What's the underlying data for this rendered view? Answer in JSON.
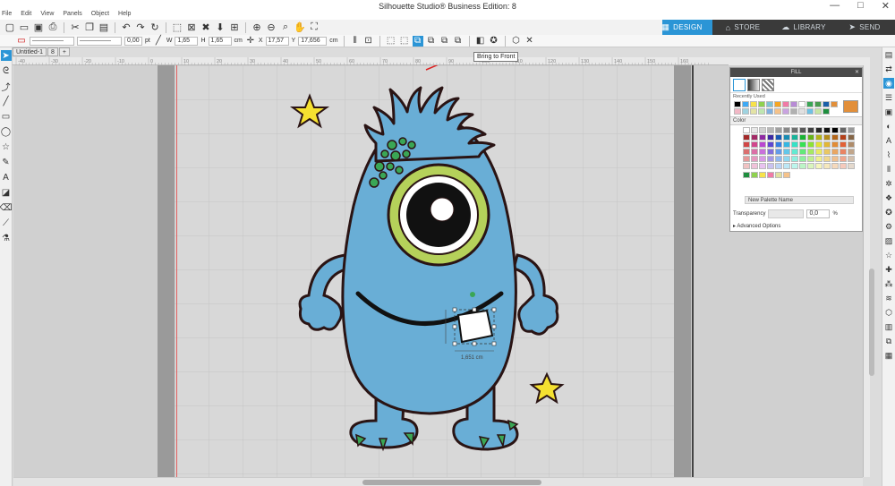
{
  "window": {
    "title": "Silhouette Studio® Business Edition: 8",
    "controls": [
      "—",
      "□",
      "✕"
    ]
  },
  "menu": [
    "File",
    "Edit",
    "View",
    "Panels",
    "Object",
    "Help"
  ],
  "nav_tabs": [
    {
      "label": "DESIGN",
      "icon": "grid-icon",
      "active": true
    },
    {
      "label": "STORE",
      "icon": "store-icon",
      "active": false
    },
    {
      "label": "LIBRARY",
      "icon": "library-icon",
      "active": false
    },
    {
      "label": "SEND",
      "icon": "send-icon",
      "active": false
    }
  ],
  "toolbar2": {
    "stroke_weight": "0,00",
    "stroke_unit": "pt",
    "w_label": "W",
    "w_value": "1,65",
    "h_label": "H",
    "h_value": "1,65",
    "size_unit": "cm",
    "x_label": "X",
    "x_value": "17,57",
    "y_label": "Y",
    "y_value": "17,656",
    "pos_unit": "cm"
  },
  "doc_tabs": [
    "Untitled-1",
    "8",
    "+"
  ],
  "tooltip": "Bring to Front",
  "ruler_labels": [
    "-40",
    "-30",
    "-20",
    "-10",
    "0",
    "10",
    "20",
    "30",
    "40",
    "50",
    "60",
    "70",
    "80",
    "90",
    "100",
    "110",
    "120",
    "130",
    "140",
    "150",
    "160"
  ],
  "fill_panel": {
    "title": "FILL",
    "recently_used_label": "Recently Used",
    "color_section": "Color",
    "palette_name": "New Palette Name",
    "transparency_label": "Transparency",
    "transparency_value": "0,0",
    "transparency_unit": "%",
    "advanced_label": "Advanced Options",
    "recent_colors": [
      "#000000",
      "#3fa9f5",
      "#f7e24a",
      "#8fd14f",
      "#7fc3d4",
      "#f5a623",
      "#f07aa6",
      "#b88bd6",
      "#ffffff",
      "#3aa655",
      "#4a9c4f",
      "#1a5fa8",
      "#e28f3a"
    ],
    "recent_colors2": [
      "#f2b8c6",
      "#9fd3e0",
      "#e3e3a5",
      "#bfe6b0",
      "#7fb0e0",
      "#f5c28a",
      "#c9a3e0",
      "#b0b0b0",
      "#e0e0e0",
      "#6ec1e4",
      "#c7e6a3",
      "#1e8e3e"
    ],
    "custom_colors": [
      "#1e8e3e",
      "#8fd14f",
      "#f7e24a",
      "#f07aa6",
      "#e0e0a0",
      "#f5c28a"
    ]
  },
  "canvas": {
    "dimension_label": "1,651 cm",
    "monster_body_color": "#69aed6",
    "eye_ring_color": "#b5d15a",
    "outline_color": "#2a1414",
    "spots_color": "#3aa655",
    "star_color": "#f5e130"
  },
  "accent": "#2b95d6"
}
